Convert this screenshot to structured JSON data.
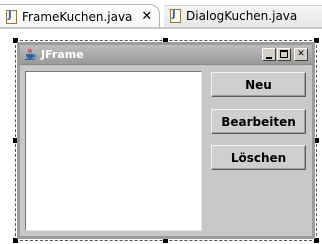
{
  "tabs": [
    {
      "label": "FrameKuchen.java",
      "active": true,
      "close_glyph": "✕",
      "icon": "java-file-icon"
    },
    {
      "label": "DialogKuchen.java",
      "active": false,
      "icon": "java-file-icon"
    }
  ],
  "jframe": {
    "title": "JFrame",
    "icon": "java-cup-icon",
    "window_buttons": [
      "minimize-icon",
      "maximize-icon",
      "close-icon"
    ],
    "close_glyph": "✕"
  },
  "buttons": {
    "neu": "Neu",
    "bearbeiten": "Bearbeiten",
    "loeschen": "Löschen"
  },
  "colors": {
    "titlebar": "#9a9a9a",
    "frame_bg": "#c8c8c8",
    "list_bg": "#ffffff"
  }
}
